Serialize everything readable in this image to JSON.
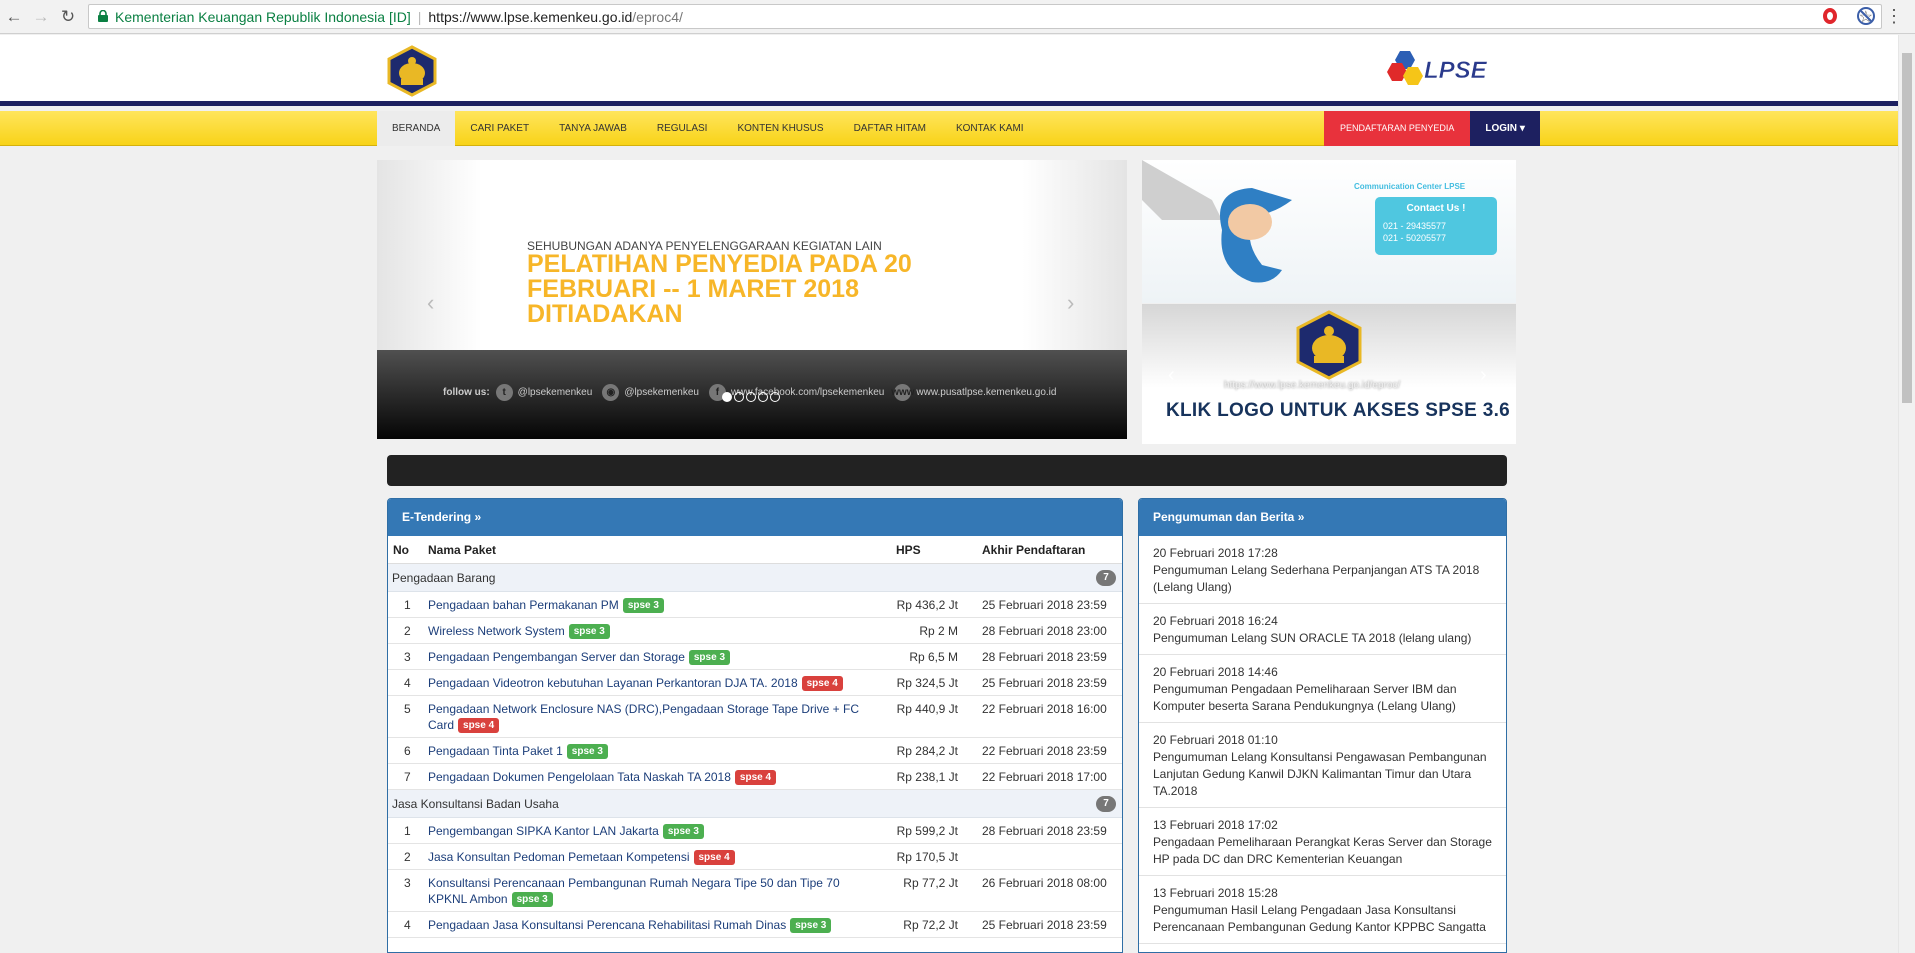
{
  "browser": {
    "secure_label": "Kementerian Keuangan Republik Indonesia [ID]",
    "url_host": "https://www.lpse.kemenkeu.go.id",
    "url_path": "/eproc4/"
  },
  "header": {
    "lpse_logo_text": "LPSE"
  },
  "nav": {
    "items": [
      "BERANDA",
      "CARI PAKET",
      "TANYA JAWAB",
      "REGULASI",
      "KONTEN KHUSUS",
      "DAFTAR HITAM",
      "KONTAK KAMI"
    ],
    "daftar": "PENDAFTARAN PENYEDIA",
    "login": "LOGIN"
  },
  "carousel": {
    "subtitle": "SEHUBUNGAN ADANYA PENYELENGGARAAN KEGIATAN LAIN",
    "title": "PELATIHAN PENYEDIA PADA 20 FEBRUARI -- 1 MARET 2018 DITIADAKAN",
    "follow_label": "follow us:",
    "social": [
      "@lpsekemenkeu",
      "@lpsekemenkeu",
      "www.facebook.com/lpsekemenkeu",
      "www.pusatlpse.kemenkeu.go.id"
    ]
  },
  "banner_cc": {
    "title": "Communication Center LPSE",
    "contact": "Contact Us !",
    "phone1": "021 - 29435577",
    "phone2": "021 - 50205577"
  },
  "banner_spse": {
    "url": "https://www.lpse.kemenkeu.go.id/eproc/",
    "cta": "KLIK LOGO UNTUK AKSES SPSE 3.6"
  },
  "tender": {
    "title": "E-Tendering »",
    "headers": {
      "no": "No",
      "name": "Nama Paket",
      "hps": "HPS",
      "date": "Akhir Pendaftaran"
    },
    "groups": [
      {
        "name": "Pengadaan Barang",
        "count": "7",
        "rows": [
          {
            "no": "1",
            "name": "Pengadaan bahan Permakanan PM",
            "tag": "spse 3",
            "hps": "Rp 436,2 Jt",
            "date": "25 Februari 2018 23:59"
          },
          {
            "no": "2",
            "name": "Wireless Network System",
            "tag": "spse 3",
            "hps": "Rp 2 M",
            "date": "28 Februari 2018 23:00"
          },
          {
            "no": "3",
            "name": "Pengadaan Pengembangan Server dan Storage",
            "tag": "spse 3",
            "hps": "Rp 6,5 M",
            "date": "28 Februari 2018 23:59"
          },
          {
            "no": "4",
            "name": "Pengadaan Videotron kebutuhan Layanan Perkantoran DJA TA. 2018",
            "tag": "spse 4",
            "hps": "Rp 324,5 Jt",
            "date": "25 Februari 2018 23:59"
          },
          {
            "no": "5",
            "name": "Pengadaan Network Enclosure NAS (DRC),Pengadaan Storage Tape Drive + FC Card",
            "tag": "spse 4",
            "hps": "Rp 440,9 Jt",
            "date": "22 Februari 2018 16:00"
          },
          {
            "no": "6",
            "name": "Pengadaan Tinta Paket 1",
            "tag": "spse 3",
            "hps": "Rp 284,2 Jt",
            "date": "22 Februari 2018 23:59"
          },
          {
            "no": "7",
            "name": "Pengadaan Dokumen Pengelolaan Tata Naskah TA 2018",
            "tag": "spse 4",
            "hps": "Rp 238,1 Jt",
            "date": "22 Februari 2018 17:00"
          }
        ]
      },
      {
        "name": "Jasa Konsultansi Badan Usaha",
        "count": "7",
        "rows": [
          {
            "no": "1",
            "name": "Pengembangan SIPKA Kantor LAN Jakarta",
            "tag": "spse 3",
            "hps": "Rp 599,2 Jt",
            "date": "28 Februari 2018 23:59"
          },
          {
            "no": "2",
            "name": "Jasa Konsultan Pedoman Pemetaan Kompetensi",
            "tag": "spse 4",
            "hps": "Rp 170,5 Jt",
            "date": ""
          },
          {
            "no": "3",
            "name": "Konsultansi Perencanaan Pembangunan Rumah Negara Tipe 50 dan Tipe 70 KPKNL Ambon",
            "tag": "spse 3",
            "hps": "Rp 77,2 Jt",
            "date": "26 Februari 2018 08:00"
          },
          {
            "no": "4",
            "name": "Pengadaan Jasa Konsultansi Perencana Rehabilitasi Rumah Dinas",
            "tag": "spse 3",
            "hps": "Rp 72,2 Jt",
            "date": "25 Februari 2018 23:59"
          }
        ]
      }
    ]
  },
  "news": {
    "title": "Pengumuman dan Berita »",
    "items": [
      {
        "date": "20 Februari 2018 17:28",
        "text": "Pengumuman Lelang Sederhana Perpanjangan ATS TA 2018 (Lelang Ulang)"
      },
      {
        "date": "20 Februari 2018 16:24",
        "text": "Pengumuman Lelang SUN ORACLE TA 2018 (lelang ulang)"
      },
      {
        "date": "20 Februari 2018 14:46",
        "text": "Pengumuman Pengadaan Pemeliharaan Server IBM dan Komputer beserta Sarana Pendukungnya (Lelang Ulang)"
      },
      {
        "date": "20 Februari 2018 01:10",
        "text": "Pengumuman Lelang Konsultansi Pengawasan Pembangunan Lanjutan Gedung Kanwil DJKN Kalimantan Timur dan Utara TA.2018"
      },
      {
        "date": "13 Februari 2018 17:02",
        "text": "Pengadaan Pemeliharaan Perangkat Keras Server dan Storage HP pada DC dan DRC Kementerian Keuangan"
      },
      {
        "date": "13 Februari 2018 15:28",
        "text": "Pengumuman Hasil Lelang Pengadaan Jasa Konsultansi Perencanaan Pembangunan Gedung Kantor KPPBC Sangatta"
      }
    ]
  }
}
